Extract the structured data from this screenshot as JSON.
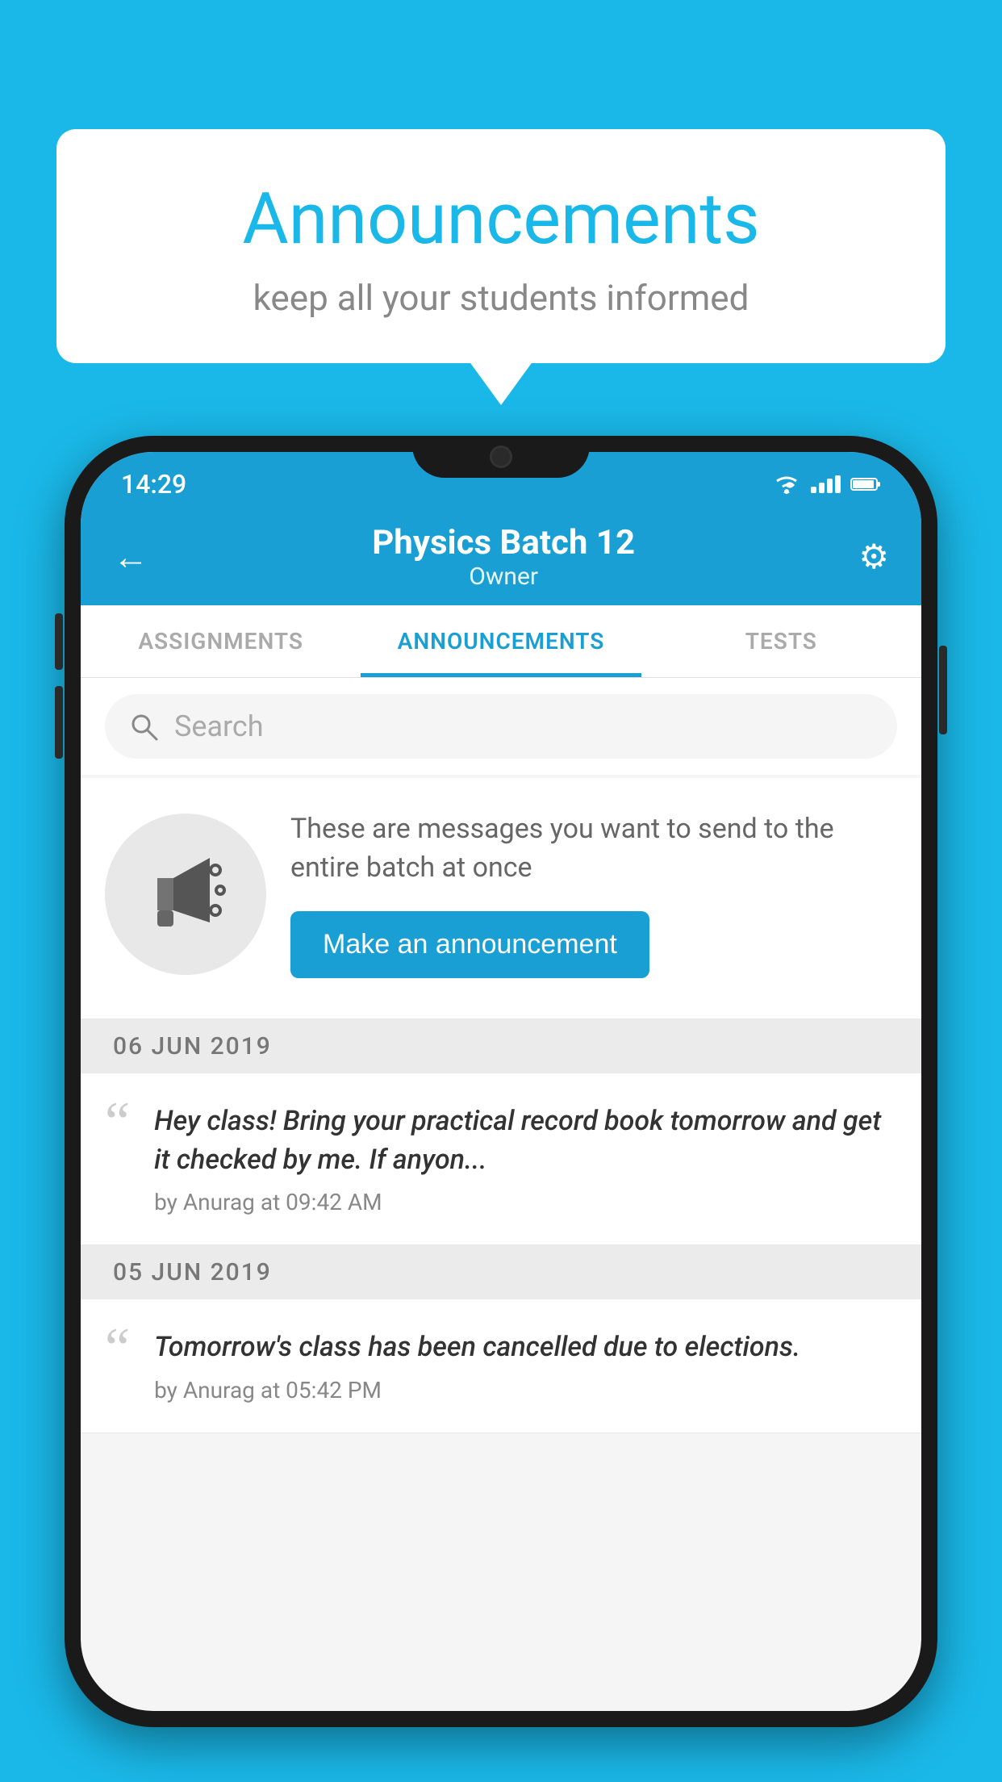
{
  "background_color": "#1ab8e8",
  "speech_bubble": {
    "title": "Announcements",
    "subtitle": "keep all your students informed"
  },
  "phone": {
    "status_bar": {
      "time": "14:29"
    },
    "header": {
      "title": "Physics Batch 12",
      "subtitle": "Owner",
      "back_label": "←",
      "gear_label": "⚙"
    },
    "tabs": [
      {
        "label": "ASSIGNMENTS",
        "active": false
      },
      {
        "label": "ANNOUNCEMENTS",
        "active": true
      },
      {
        "label": "TESTS",
        "active": false
      }
    ],
    "search": {
      "placeholder": "Search"
    },
    "promo": {
      "text": "These are messages you want to send to the entire batch at once",
      "button_label": "Make an announcement"
    },
    "announcements": [
      {
        "date": "06  JUN  2019",
        "text": "Hey class! Bring your practical record book tomorrow and get it checked by me. If anyon...",
        "meta": "by Anurag at 09:42 AM"
      },
      {
        "date": "05  JUN  2019",
        "text": "Tomorrow's class has been cancelled due to elections.",
        "meta": "by Anurag at 05:42 PM"
      }
    ]
  }
}
